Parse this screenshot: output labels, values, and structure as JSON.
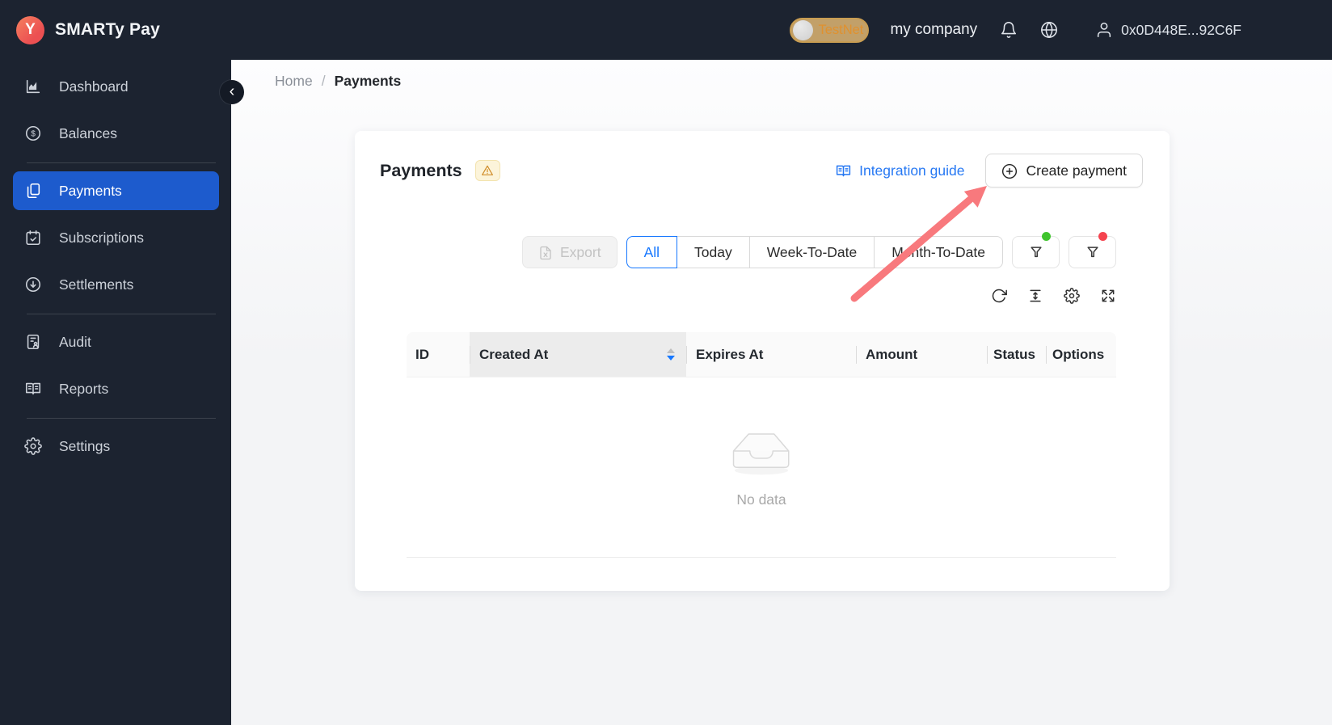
{
  "app": {
    "name": "SMARTy Pay",
    "logo_letter": "Y"
  },
  "header": {
    "network_toggle_label": "TestNet",
    "company_name": "my company",
    "wallet_address": "0x0D448E...92C6F"
  },
  "sidebar": {
    "items": [
      {
        "label": "Dashboard",
        "icon": "chart-icon"
      },
      {
        "label": "Balances",
        "icon": "dollar-circle-icon"
      },
      {
        "label": "Payments",
        "icon": "pages-icon",
        "active": true
      },
      {
        "label": "Subscriptions",
        "icon": "calendar-check-icon"
      },
      {
        "label": "Settlements",
        "icon": "download-circle-icon"
      },
      {
        "label": "Audit",
        "icon": "audit-document-icon"
      },
      {
        "label": "Reports",
        "icon": "open-book-icon"
      },
      {
        "label": "Settings",
        "icon": "gear-icon"
      }
    ]
  },
  "breadcrumb": {
    "home": "Home",
    "separator": "/",
    "current": "Payments"
  },
  "page": {
    "title": "Payments",
    "integration_guide_label": "Integration guide",
    "create_payment_label": "Create payment"
  },
  "filters": {
    "export_label": "Export",
    "ranges": [
      {
        "label": "All",
        "active": true
      },
      {
        "label": "Today"
      },
      {
        "label": "Week-To-Date"
      },
      {
        "label": "Month-To-Date"
      }
    ]
  },
  "table": {
    "columns": [
      "ID",
      "Created At",
      "Expires At",
      "Amount",
      "Status",
      "Options"
    ],
    "sorted_column": "Created At",
    "sort_direction": "descending",
    "empty_text": "No data"
  },
  "colors": {
    "accent_blue": "#1677ff",
    "link_blue": "#2678f3",
    "active_nav_blue": "#1d5bcd",
    "header_bg": "#1c2330",
    "arrow_annotation": "#f8797d",
    "warning_orange": "#d08c28",
    "filter_dot_green": "#3fc42d",
    "filter_dot_red": "#f5434f",
    "logo_coral": "#ef5a52"
  }
}
